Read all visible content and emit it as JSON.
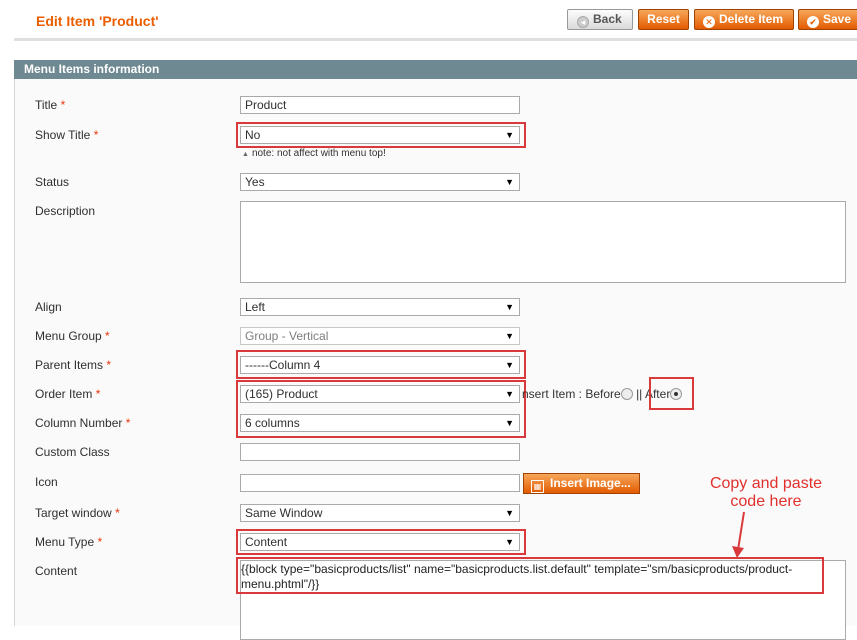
{
  "header": {
    "title": "Edit Item 'Product'",
    "buttons": {
      "back": "Back",
      "reset": "Reset",
      "delete": "Delete Item",
      "save": "Save"
    }
  },
  "section": {
    "title": "Menu Items information"
  },
  "form": {
    "title": {
      "label": "Title",
      "value": "Product"
    },
    "show_title": {
      "label": "Show Title",
      "value": "No",
      "note": "note: not affect with menu top!"
    },
    "status": {
      "label": "Status",
      "value": "Yes"
    },
    "description": {
      "label": "Description",
      "value": ""
    },
    "align": {
      "label": "Align",
      "value": "Left"
    },
    "menu_group": {
      "label": "Menu Group",
      "value": "Group - Vertical"
    },
    "parent_items": {
      "label": "Parent Items",
      "value": "------Column 4"
    },
    "order_item": {
      "label": "Order Item",
      "value": "(165) Product",
      "insert_text": "nsert Item : Before",
      "separator": "||",
      "after_label": "After"
    },
    "column_number": {
      "label": "Column Number",
      "value": "6 columns"
    },
    "custom_class": {
      "label": "Custom Class",
      "value": ""
    },
    "icon": {
      "label": "Icon",
      "value": "",
      "insert_button": "Insert Image..."
    },
    "target_window": {
      "label": "Target window",
      "value": "Same Window"
    },
    "menu_type": {
      "label": "Menu Type",
      "value": "Content"
    },
    "content": {
      "label": "Content",
      "value": "{{block type=\"basicproducts/list\" name=\"basicproducts.list.default\" template=\"sm/basicproducts/product-menu.phtml\"/}}"
    }
  },
  "required_marker": "*",
  "annotation": {
    "callout": "Copy and paste code here"
  },
  "colors": {
    "accent": "#eb5e00",
    "section_header": "#6f8992",
    "highlight": "#d9393b"
  }
}
